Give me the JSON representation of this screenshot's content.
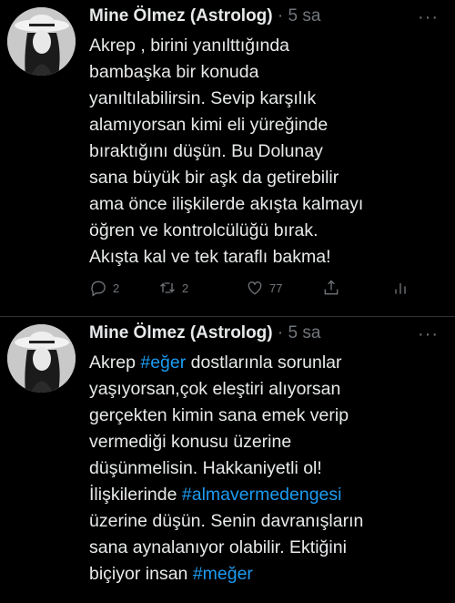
{
  "tweets": [
    {
      "author": "Mine Ölmez (Astrolog)",
      "separator": "·",
      "time": "5 sa",
      "more": "···",
      "lines": [
        [
          {
            "t": "Akrep , birini yanılttığında"
          }
        ],
        [
          {
            "t": "bambaşka bir konuda"
          }
        ],
        [
          {
            "t": "yanıltılabilirsin. Sevip karşılık"
          }
        ],
        [
          {
            "t": "alamıyorsan kimi eli yüreğinde"
          }
        ],
        [
          {
            "t": "bıraktığını düşün. Bu Dolunay"
          }
        ],
        [
          {
            "t": "sana büyük bir aşk da getirebilir"
          }
        ],
        [
          {
            "t": "ama önce ilişkilerde akışta kalmayı"
          }
        ],
        [
          {
            "t": "öğren ve kontrolcülüğü bırak."
          }
        ],
        [
          {
            "t": "Akışta kal ve tek taraflı bakma!"
          }
        ]
      ],
      "actions": {
        "reply_count": "2",
        "retweet_count": "2",
        "like_count": "77"
      }
    },
    {
      "author": "Mine Ölmez (Astrolog)",
      "separator": "·",
      "time": "5 sa",
      "more": "···",
      "lines": [
        [
          {
            "t": "Akrep "
          },
          {
            "t": "#eğer",
            "tag": true
          },
          {
            "t": " dostlarınla sorunlar"
          }
        ],
        [
          {
            "t": "yaşıyorsan,çok eleştiri alıyorsan"
          }
        ],
        [
          {
            "t": "gerçekten kimin sana emek verip"
          }
        ],
        [
          {
            "t": "vermediği konusu üzerine"
          }
        ],
        [
          {
            "t": "düşünmelisin. Hakkaniyetli ol!"
          }
        ],
        [
          {
            "t": "İlişkilerinde "
          },
          {
            "t": "#almavermedengesi",
            "tag": true
          }
        ],
        [
          {
            "t": "üzerine düşün. Senin davranışların"
          }
        ],
        [
          {
            "t": "sana aynalanıyor olabilir. Ektiğini"
          }
        ],
        [
          {
            "t": "biçiyor insan "
          },
          {
            "t": "#meğer",
            "tag": true
          }
        ]
      ]
    }
  ],
  "colors": {
    "background": "#000000",
    "text": "#e7e9ea",
    "muted": "#71767b",
    "hashtag": "#1d9bf0",
    "divider": "#2f3336"
  },
  "icons": [
    "avatar",
    "more-icon",
    "reply-icon",
    "retweet-icon",
    "like-icon",
    "share-icon",
    "analytics-icon"
  ]
}
